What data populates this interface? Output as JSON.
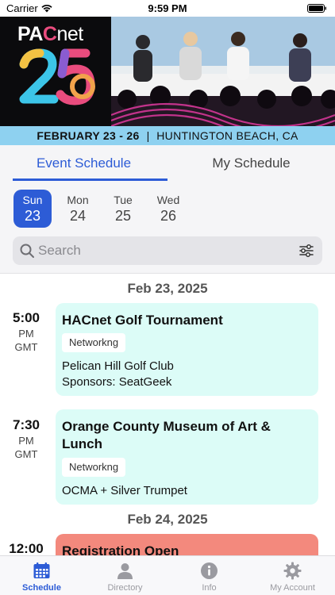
{
  "status_bar": {
    "carrier": "Carrier",
    "time": "9:59 PM"
  },
  "banner": {
    "logo_pac_prefix": "PA",
    "logo_pac_c": "C",
    "logo_net": "net",
    "logo_number": "25",
    "dates": "FEBRUARY 23 - 26",
    "separator": "|",
    "location": "HUNTINGTON BEACH, CA"
  },
  "tabs": [
    {
      "label": "Event Schedule",
      "active": true
    },
    {
      "label": "My Schedule",
      "active": false
    }
  ],
  "days": [
    {
      "name": "Sun",
      "num": "23",
      "selected": true
    },
    {
      "name": "Mon",
      "num": "24",
      "selected": false
    },
    {
      "name": "Tue",
      "num": "25",
      "selected": false
    },
    {
      "name": "Wed",
      "num": "26",
      "selected": false
    }
  ],
  "search": {
    "placeholder": "Search"
  },
  "schedule": {
    "date_1": "Feb 23, 2025",
    "date_2": "Feb 24, 2025",
    "events": [
      {
        "time": "5:00",
        "ampm": "PM",
        "tz": "GMT",
        "title": "HACnet Golf Tournament",
        "tag": "Networkng",
        "line1": "Pelican Hill Golf Club",
        "line2": "Sponsors: SeatGeek"
      },
      {
        "time": "7:30",
        "ampm": "PM",
        "tz": "GMT",
        "title": "Orange County Museum of Art & Lunch",
        "tag": "Networkng",
        "line1": "OCMA + Silver Trumpet"
      },
      {
        "time": "12:00",
        "title": "Registration Open"
      }
    ]
  },
  "tab_bar": [
    {
      "label": "Schedule",
      "icon": "calendar-icon",
      "active": true
    },
    {
      "label": "Directory",
      "icon": "person-icon",
      "active": false
    },
    {
      "label": "Info",
      "icon": "info-icon",
      "active": false
    },
    {
      "label": "My Account",
      "icon": "gear-icon",
      "active": false
    }
  ],
  "colors": {
    "accent": "#2d5cd6",
    "card_teal": "#dcfcf7",
    "card_red": "#f3897d",
    "banner_strip": "#8ed1f0"
  }
}
